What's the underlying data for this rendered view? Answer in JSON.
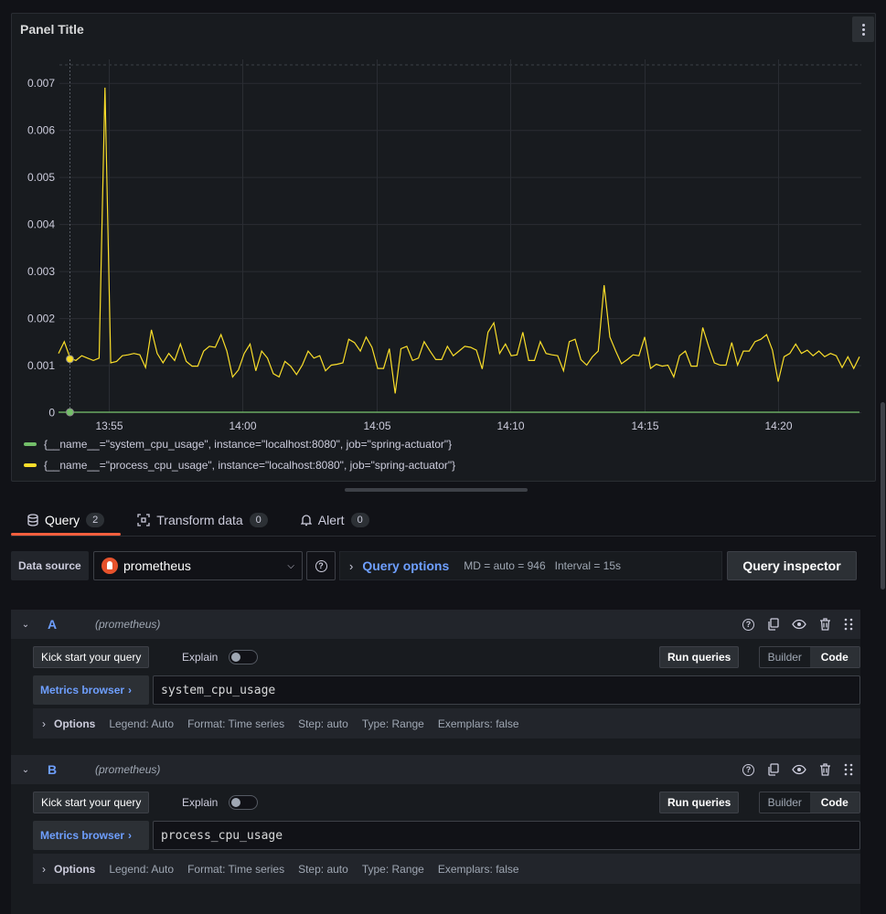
{
  "panel": {
    "title": "Panel Title",
    "legend": [
      {
        "label": "{__name__=\"system_cpu_usage\", instance=\"localhost:8080\", job=\"spring-actuator\"}",
        "color": "#73bf69"
      },
      {
        "label": "{__name__=\"process_cpu_usage\", instance=\"localhost:8080\", job=\"spring-actuator\"}",
        "color": "#fade2a"
      }
    ]
  },
  "chart_data": {
    "type": "line",
    "y_ticks": [
      "0",
      "0.001",
      "0.002",
      "0.003",
      "0.004",
      "0.005",
      "0.006",
      "0.007"
    ],
    "x_ticks": [
      "13:55",
      "14:00",
      "14:05",
      "14:10",
      "14:15",
      "14:20"
    ],
    "ylim": [
      0,
      0.0075
    ],
    "series": [
      {
        "name": "{__name__=\"system_cpu_usage\", instance=\"localhost:8080\", job=\"spring-actuator\"}",
        "color": "#73bf69",
        "values": [
          0,
          0
        ]
      },
      {
        "name": "{__name__=\"process_cpu_usage\", instance=\"localhost:8080\", job=\"spring-actuator\"}",
        "color": "#fade2a",
        "values": [
          0.00125,
          0.0015,
          0.00115,
          0.0011,
          0.0012,
          0.00115,
          0.0011,
          0.00115,
          0.0069,
          0.00105,
          0.00108,
          0.0012,
          0.00122,
          0.00125,
          0.00122,
          0.00095,
          0.00175,
          0.00125,
          0.00105,
          0.00125,
          0.0011,
          0.00145,
          0.00108,
          0.00098,
          0.00098,
          0.0013,
          0.0014,
          0.00138,
          0.00165,
          0.0013,
          0.00075,
          0.0009,
          0.00125,
          0.00145,
          0.00088,
          0.0013,
          0.00115,
          0.00082,
          0.00075,
          0.00108,
          0.00098,
          0.0008,
          0.001,
          0.0013,
          0.00115,
          0.0012,
          0.00088,
          0.001,
          0.00102,
          0.00105,
          0.00155,
          0.00148,
          0.0013,
          0.0016,
          0.00138,
          0.00093,
          0.00093,
          0.00135,
          0.0004,
          0.00135,
          0.0014,
          0.0011,
          0.00115,
          0.0015,
          0.0013,
          0.00112,
          0.00112,
          0.0014,
          0.0012,
          0.0013,
          0.0014,
          0.00138,
          0.00132,
          0.00092,
          0.0017,
          0.0019,
          0.00125,
          0.00145,
          0.0012,
          0.00122,
          0.0017,
          0.0011,
          0.0011,
          0.0015,
          0.00125,
          0.00122,
          0.0012,
          0.00088,
          0.0015,
          0.00155,
          0.00112,
          0.001,
          0.00118,
          0.0013,
          0.0027,
          0.0016,
          0.0013,
          0.00103,
          0.00112,
          0.00122,
          0.0012,
          0.0016,
          0.00093,
          0.00102,
          0.00098,
          0.001,
          0.00075,
          0.0012,
          0.0013,
          0.00098,
          0.00098,
          0.0018,
          0.0014,
          0.00105,
          0.001,
          0.001,
          0.00148,
          0.001,
          0.0013,
          0.0013,
          0.0015,
          0.00155,
          0.00165,
          0.00132,
          0.00065,
          0.00118,
          0.00125,
          0.00145,
          0.00125,
          0.00132,
          0.0012,
          0.0013,
          0.00118,
          0.00125,
          0.0012,
          0.00095,
          0.00118,
          0.00093,
          0.00118
        ]
      }
    ]
  },
  "tabs": [
    {
      "label": "Query",
      "count": "2"
    },
    {
      "label": "Transform data",
      "count": "0"
    },
    {
      "label": "Alert",
      "count": "0"
    }
  ],
  "datasource": {
    "label": "Data source",
    "name": "prometheus",
    "query_options": "Query options",
    "md": "MD = auto = 946",
    "interval": "Interval = 15s",
    "inspector": "Query inspector"
  },
  "queries": [
    {
      "letter": "A",
      "ds": "(prometheus)",
      "kick": "Kick start your query",
      "explain": "Explain",
      "run": "Run queries",
      "builder": "Builder",
      "code_label": "Code",
      "metrics_browser": "Metrics browser",
      "expr": "system_cpu_usage",
      "options_label": "Options",
      "legend": "Legend: Auto",
      "format": "Format: Time series",
      "step": "Step: auto",
      "type": "Type: Range",
      "exemplars": "Exemplars: false"
    },
    {
      "letter": "B",
      "ds": "(prometheus)",
      "kick": "Kick start your query",
      "explain": "Explain",
      "run": "Run queries",
      "builder": "Builder",
      "code_label": "Code",
      "metrics_browser": "Metrics browser",
      "expr": "process_cpu_usage",
      "options_label": "Options",
      "legend": "Legend: Auto",
      "format": "Format: Time series",
      "step": "Step: auto",
      "type": "Type: Range",
      "exemplars": "Exemplars: false"
    }
  ]
}
